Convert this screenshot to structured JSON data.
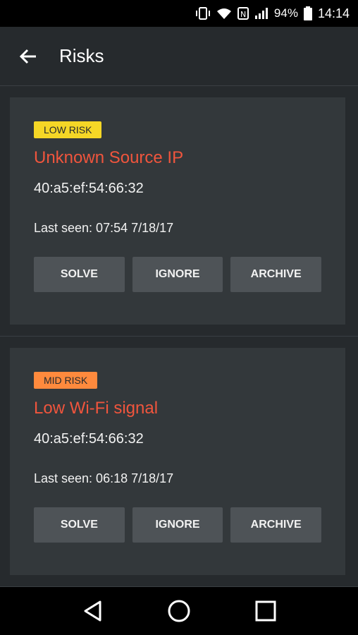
{
  "status": {
    "battery": "94%",
    "time": "14:14",
    "icons": [
      "vibrate-icon",
      "wifi-icon",
      "nfc-icon",
      "signal-icon",
      "battery-icon"
    ]
  },
  "header": {
    "title": "Risks"
  },
  "risks": [
    {
      "level": "LOW RISK",
      "level_color": "#f5d726",
      "title": "Unknown Source IP",
      "mac": "40:a5:ef:54:66:32",
      "last_seen": "Last seen: 07:54 7/18/17",
      "actions": [
        "SOLVE",
        "IGNORE",
        "ARCHIVE"
      ]
    },
    {
      "level": "MID RISK",
      "level_color": "#ff8a3d",
      "title": "Low Wi-Fi signal",
      "mac": "40:a5:ef:54:66:32",
      "last_seen": "Last seen: 06:18 7/18/17",
      "actions": [
        "SOLVE",
        "IGNORE",
        "ARCHIVE"
      ]
    }
  ],
  "colors": {
    "background": "#262a2d",
    "card": "#33383b",
    "title_accent": "#f0553d",
    "button": "#4e5357"
  },
  "nav": [
    "back-triangle-icon",
    "home-circle-icon",
    "recents-square-icon"
  ]
}
